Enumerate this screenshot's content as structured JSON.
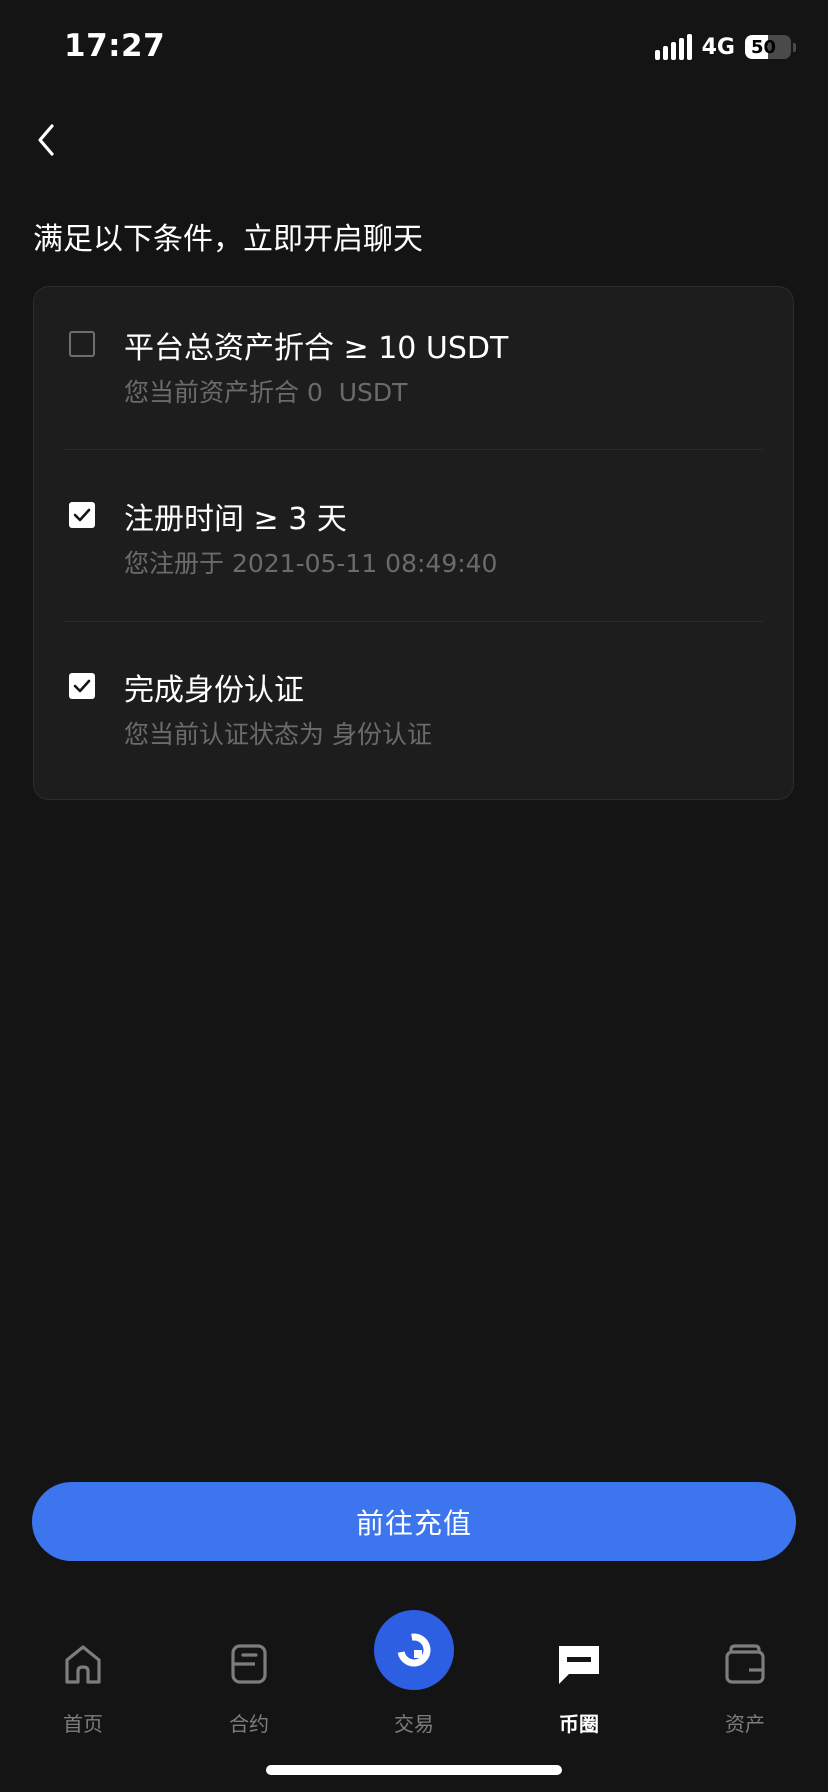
{
  "status_bar": {
    "time": "17:27",
    "network": "4G",
    "battery": "50"
  },
  "page": {
    "title": "满足以下条件，立即开启聊天"
  },
  "conditions": [
    {
      "title": "平台总资产折合 ≥ 10 USDT",
      "detail": "您当前资产折合 0  USDT",
      "checked": false
    },
    {
      "title": "注册时间 ≥ 3 天",
      "detail": "您注册于 2021-05-11 08:49:40",
      "checked": true
    },
    {
      "title": "完成身份认证",
      "detail": "您当前认证状态为 身份认证",
      "checked": true
    }
  ],
  "cta": {
    "label": "前往充值"
  },
  "tab_bar": {
    "items": [
      {
        "label": "首页",
        "icon": "home-icon",
        "active": false
      },
      {
        "label": "合约",
        "icon": "contract-icon",
        "active": false
      },
      {
        "label": "交易",
        "icon": "trade-icon",
        "active": false
      },
      {
        "label": "币圈",
        "icon": "chat-icon",
        "active": true
      },
      {
        "label": "资产",
        "icon": "wallet-icon",
        "active": false
      }
    ]
  },
  "colors": {
    "background": "#141414",
    "card": "#1d1d1d",
    "accent": "#3c75ee",
    "trade_circle": "#2d5fe3",
    "muted_text": "#6b6b6b"
  }
}
